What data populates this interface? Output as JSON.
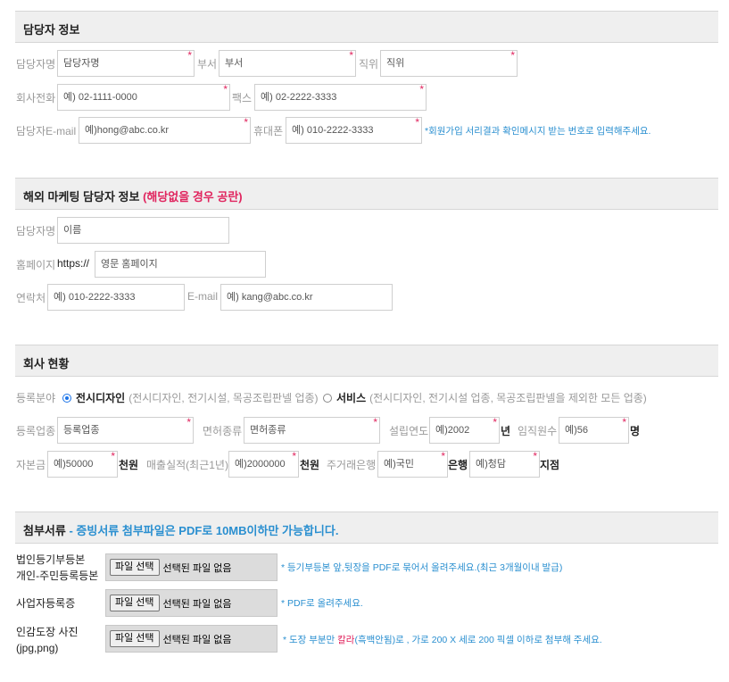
{
  "contact": {
    "title": "담당자 정보",
    "name_label": "담당자명",
    "name_placeholder": "담당자명",
    "dept_label": "부서",
    "dept_placeholder": "부서",
    "position_label": "직위",
    "position_placeholder": "직위",
    "phone_label": "회사전화",
    "phone_placeholder": "예) 02-1111-0000",
    "fax_label": "팩스",
    "fax_placeholder": "예) 02-2222-3333",
    "email_label": "담당자E-mail",
    "email_placeholder": "예)hong@abc.co.kr",
    "mobile_label": "휴대폰",
    "mobile_placeholder": "예) 010-2222-3333",
    "mobile_note": "*회원가입 서리결과 확인메시지 받는 번호로 입력해주세요.",
    "required_mark": "*"
  },
  "overseas": {
    "title": "해외 마케팅 담당자 정보",
    "title_note": "(해당없을 경우 공란)",
    "name_label": "담당자명",
    "name_placeholder": "이름",
    "homepage_label": "홈페이지",
    "homepage_prefix": "https://",
    "homepage_placeholder": "영문 홈페이지",
    "contact_label": "연락처",
    "contact_placeholder": "예) 010-2222-3333",
    "email_label": "E-mail",
    "email_placeholder": "예) kang@abc.co.kr"
  },
  "company": {
    "title": "회사 현황",
    "reg_label": "등록분야",
    "option1_name": "전시디자인",
    "option1_desc": "(전시디자인, 전기시설, 목공조립판넬 업종)",
    "option2_name": "서비스",
    "option2_desc": "(전시디자인, 전기시설 업종, 목공조립판넬을 제외한 모든 업종)",
    "biz_label": "등록업종",
    "biz_placeholder": "등록업종",
    "license_label": "면허종류",
    "license_placeholder": "면허종류",
    "founded_label": "설립연도",
    "founded_placeholder": "예)2002",
    "founded_unit": "년",
    "staff_label": "임직원수",
    "staff_placeholder": "예)56",
    "staff_unit": "명",
    "capital_label": "자본금",
    "capital_placeholder": "예)50000",
    "capital_unit": "천원",
    "sales_label": "매출실적(최근1년)",
    "sales_placeholder": "예)2000000",
    "sales_unit": "천원",
    "bank_label": "주거래은행",
    "bank_placeholder": "예)국민",
    "bank_unit": "은행",
    "branch_placeholder": "예)청담",
    "branch_unit": "지점",
    "required_mark": "*"
  },
  "attachments": {
    "title": "첨부서류",
    "title_note": "- 증빙서류 첨부파일은 PDF로 10MB이하만 가능합니다.",
    "choose_label": "파일 선택",
    "no_file_label": "선택된 파일 없음",
    "items": [
      {
        "label_line1": "법인등기부등본",
        "label_line2": "개인-주민등록등본",
        "note": "* 등기부등본 앞,뒷장을 PDF로 묶어서 올려주세요.(최근 3개월이내 발급)"
      },
      {
        "label_line1": "사업자등록증",
        "label_line2": "",
        "note": "* PDF로 올려주세요."
      },
      {
        "label_line1": "인감도장 사진",
        "label_line2": "(jpg,png)",
        "note_pre": "* 도장 부분만 ",
        "note_red": "칼라",
        "note_post": "(흑백안됨)로 , 가로 200 X 세로 200 픽셀 이하로 첨부해 주세요."
      }
    ]
  }
}
